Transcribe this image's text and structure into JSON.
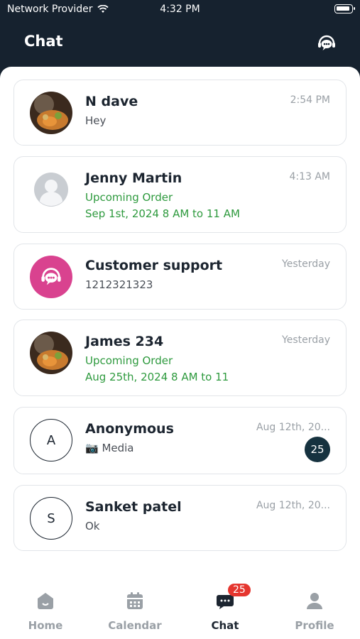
{
  "status_bar": {
    "carrier": "Network Provider",
    "time": "4:32 PM"
  },
  "header": {
    "title": "Chat"
  },
  "chats": [
    {
      "name": "N dave",
      "lines": [
        "Hey"
      ],
      "time": "2:54 PM",
      "avatar": "food-photo"
    },
    {
      "name": "Jenny Martin",
      "lines": [
        "Upcoming Order",
        "Sep 1st, 2024 8 AM to 11 AM"
      ],
      "time": "4:13 AM",
      "avatar": "placeholder"
    },
    {
      "name": "Customer support",
      "lines": [
        "1212321323"
      ],
      "time": "Yesterday",
      "avatar": "support"
    },
    {
      "name": "James 234",
      "lines": [
        "Upcoming Order",
        "Aug 25th, 2024 8 AM to 11"
      ],
      "time": "Yesterday",
      "avatar": "food-photo"
    },
    {
      "name": "Anonymous",
      "lines": [
        "📷 Media"
      ],
      "time": "Aug 12th, 20...",
      "avatar": "A",
      "unread": "25"
    },
    {
      "name": "Sanket patel",
      "lines": [
        "Ok"
      ],
      "time": "Aug 12th, 20...",
      "avatar": "S"
    }
  ],
  "tabs": [
    {
      "label": "Home",
      "icon": "home-icon"
    },
    {
      "label": "Calendar",
      "icon": "calendar-icon"
    },
    {
      "label": "Chat",
      "icon": "chat-icon",
      "badge": "25",
      "active": true
    },
    {
      "label": "Profile",
      "icon": "profile-icon"
    }
  ],
  "colors": {
    "header_bg": "#16222f",
    "accent_green": "#2e9a3e",
    "support_pink": "#d9428f",
    "badge_red": "#e5362f",
    "unread_bg": "#16323f"
  }
}
